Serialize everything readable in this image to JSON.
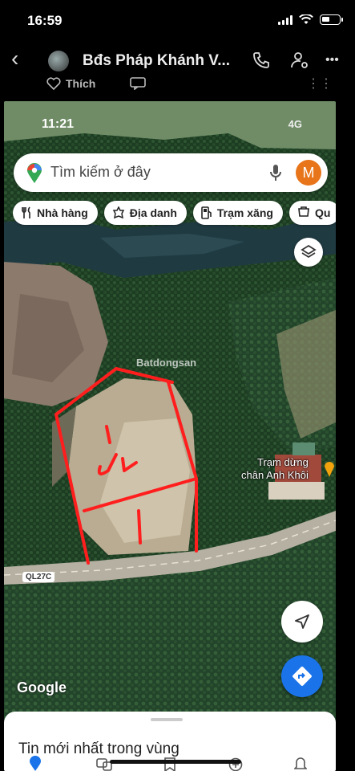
{
  "status_bar": {
    "time": "16:59"
  },
  "header": {
    "back": "‹",
    "title": "Bđs Pháp Khánh V...",
    "more": "•••"
  },
  "reaction": {
    "like_label": "Thích",
    "more": "⋮⋮"
  },
  "shared_image": {
    "status": {
      "time": "11:21",
      "network": "4G"
    },
    "search": {
      "placeholder": "Tìm kiếm ở đây",
      "avatar_letter": "M"
    },
    "chips": [
      {
        "label": "Nhà hàng",
        "icon": "fork-knife-icon"
      },
      {
        "label": "Địa danh",
        "icon": "landmark-icon"
      },
      {
        "label": "Trạm xăng",
        "icon": "gas-station-icon"
      },
      {
        "label": "Qu",
        "icon": "shopping-icon"
      }
    ],
    "map": {
      "road_label": "QL27C",
      "place_label_line1": "Trạm dừng",
      "place_label_line2": "chân Anh Khôi",
      "watermark": "Batdongsan",
      "handwritten": "2L",
      "google": "Google",
      "annotation_color": "#ff1e1e"
    },
    "sheet": {
      "title": "Tin mới nhất trong vùng"
    }
  }
}
